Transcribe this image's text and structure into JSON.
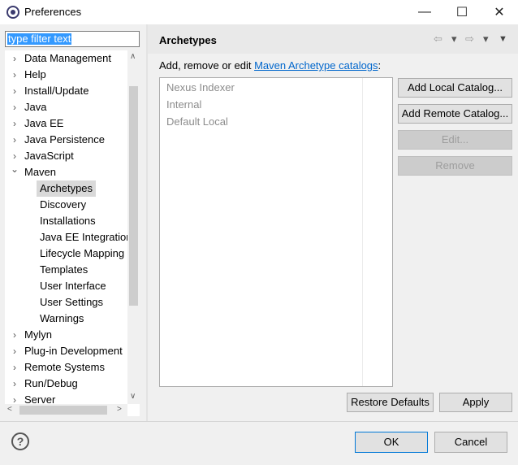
{
  "window": {
    "title": "Preferences",
    "minimize": "—",
    "maximize": "☐",
    "close": "✕"
  },
  "filter": {
    "value": "type filter text"
  },
  "tree": {
    "items": [
      {
        "label": "Data Management",
        "level": 0,
        "expanded": false
      },
      {
        "label": "Help",
        "level": 0,
        "expanded": false
      },
      {
        "label": "Install/Update",
        "level": 0,
        "expanded": false
      },
      {
        "label": "Java",
        "level": 0,
        "expanded": false
      },
      {
        "label": "Java EE",
        "level": 0,
        "expanded": false
      },
      {
        "label": "Java Persistence",
        "level": 0,
        "expanded": false
      },
      {
        "label": "JavaScript",
        "level": 0,
        "expanded": false
      },
      {
        "label": "Maven",
        "level": 0,
        "expanded": true
      },
      {
        "label": "Archetypes",
        "level": 1,
        "selected": true
      },
      {
        "label": "Discovery",
        "level": 1
      },
      {
        "label": "Installations",
        "level": 1
      },
      {
        "label": "Java EE Integration",
        "level": 1
      },
      {
        "label": "Lifecycle Mapping",
        "level": 1
      },
      {
        "label": "Templates",
        "level": 1
      },
      {
        "label": "User Interface",
        "level": 1
      },
      {
        "label": "User Settings",
        "level": 1
      },
      {
        "label": "Warnings",
        "level": 1
      },
      {
        "label": "Mylyn",
        "level": 0,
        "expanded": false
      },
      {
        "label": "Plug-in Development",
        "level": 0,
        "expanded": false
      },
      {
        "label": "Remote Systems",
        "level": 0,
        "expanded": false
      },
      {
        "label": "Run/Debug",
        "level": 0,
        "expanded": false
      },
      {
        "label": "Server",
        "level": 0,
        "expanded": false
      }
    ]
  },
  "page": {
    "title": "Archetypes",
    "desc_prefix": "Add, remove or edit ",
    "desc_link": "Maven Archetype catalogs",
    "desc_suffix": ":"
  },
  "catalogs": [
    "Nexus Indexer",
    "Internal",
    "Default Local"
  ],
  "buttons": {
    "add_local": "Add Local Catalog...",
    "add_remote": "Add Remote Catalog...",
    "edit": "Edit...",
    "remove": "Remove",
    "restore": "Restore Defaults",
    "apply": "Apply",
    "ok": "OK",
    "cancel": "Cancel"
  },
  "icons": {
    "back": "⇦",
    "forward": "⇨",
    "dropdown": "▾",
    "menu": "▼",
    "help": "?",
    "chevron_right": "›",
    "chevron_down": "⌄"
  }
}
